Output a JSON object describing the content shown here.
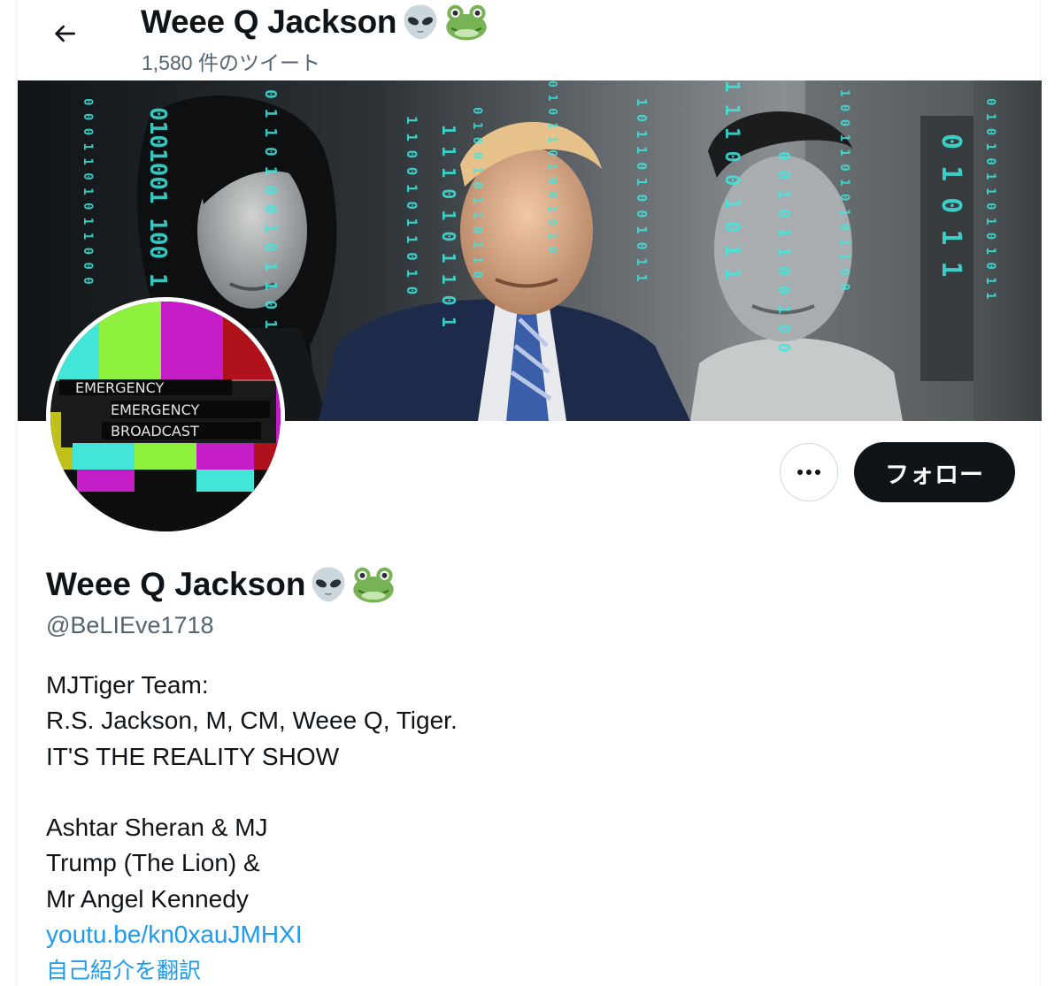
{
  "header": {
    "display_name": "Weee Q Jackson",
    "tweet_count": "1,580 件のツイート",
    "back_icon": "arrow-left-icon"
  },
  "profile": {
    "display_name": "Weee Q Jackson",
    "name_emojis": [
      "alien-icon",
      "frog-icon"
    ],
    "handle": "@BeLIEve1718",
    "bio_lines": [
      "MJTiger Team:",
      "R.S. Jackson, M, CM, Weee Q, Tiger.",
      "IT'S THE REALITY SHOW",
      "",
      "Ashtar Sheran & MJ",
      "Trump (The Lion) &",
      "Mr Angel Kennedy"
    ],
    "link": "youtu.be/kn0xauJMHXI",
    "translate_label": "自己紹介を翻訳"
  },
  "actions": {
    "more_icon": "more-horizontal-icon",
    "follow_label": "フォロー"
  },
  "avatar": {
    "lines": [
      "EMERGENCY",
      "EMERGENCY",
      "BROADCAST"
    ]
  },
  "colors": {
    "text_primary": "#0f1419",
    "text_secondary": "#536471",
    "link": "#1d9bf0",
    "button_dark": "#0f1419",
    "border": "#cfd9de"
  }
}
